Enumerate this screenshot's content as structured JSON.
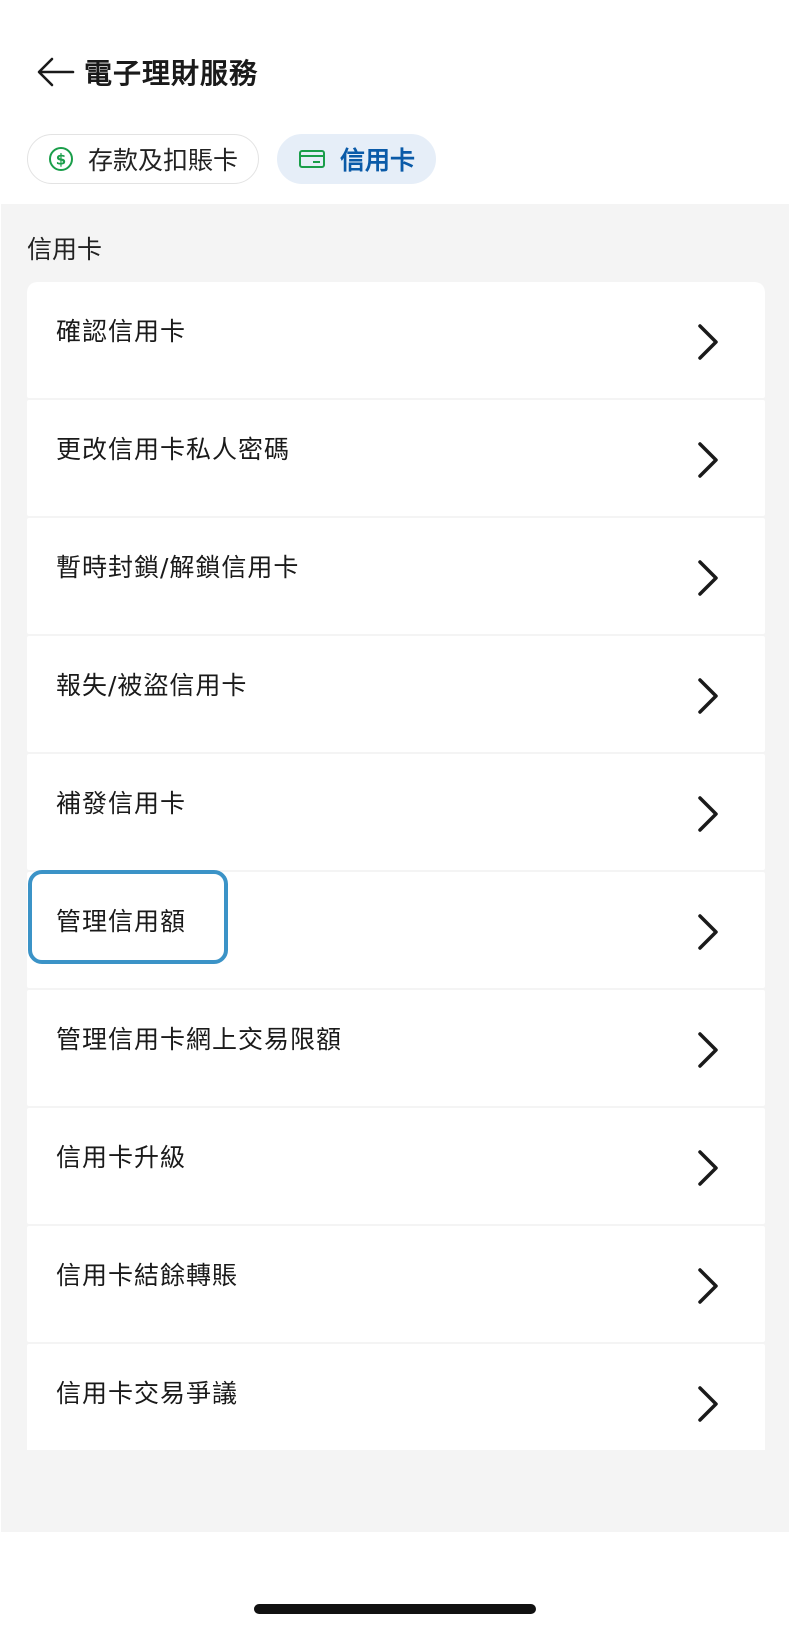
{
  "header": {
    "title": "電子理財服務",
    "back_icon": "arrow-left-icon"
  },
  "tabs": [
    {
      "label": "存款及扣賬卡",
      "icon": "dollar-circle-icon",
      "icon_color": "#1a9e4a",
      "selected": false
    },
    {
      "label": "信用卡",
      "icon": "credit-card-icon",
      "icon_color": "#1a9e4a",
      "selected": true
    }
  ],
  "section": {
    "title": "信用卡",
    "items": [
      {
        "label": "確認信用卡"
      },
      {
        "label": "更改信用卡私人密碼"
      },
      {
        "label": "暫時封鎖/解鎖信用卡"
      },
      {
        "label": "報失/被盜信用卡"
      },
      {
        "label": "補發信用卡"
      },
      {
        "label": "管理信用額"
      },
      {
        "label": "管理信用卡網上交易限額"
      },
      {
        "label": "信用卡升級"
      },
      {
        "label": "信用卡結餘轉賬"
      },
      {
        "label": "信用卡交易爭議"
      }
    ]
  },
  "colors": {
    "accent": "#0a5aa8",
    "highlight": "#3b93c7",
    "tab_selected_bg": "#e6eef8"
  }
}
